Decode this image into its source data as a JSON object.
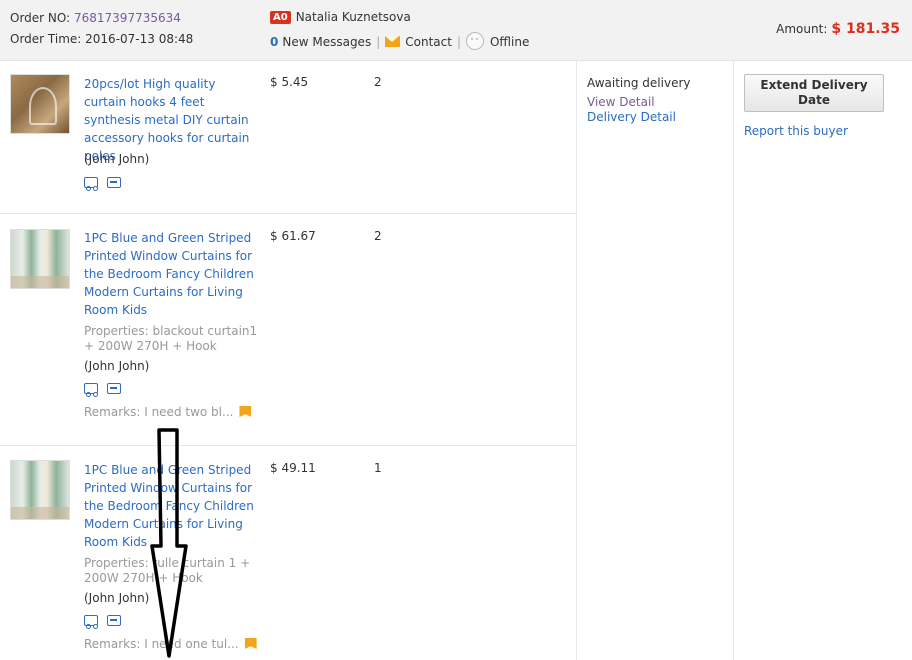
{
  "header": {
    "order_no_label": "Order NO:",
    "order_no": "76817397735634",
    "order_time_label": "Order Time:",
    "order_time": "2016-07-13 08:48",
    "buyer_badge": "A0",
    "buyer_name": "Natalia Kuznetsova",
    "message_count": "0",
    "messages_label": "New Messages",
    "contact_label": "Contact",
    "offline_label": "Offline",
    "amount_label": "Amount:",
    "amount_value": "$ 181.35"
  },
  "items": [
    {
      "title": "20pcs/lot High quality curtain hooks 4 feet synthesis metal DIY curtain accessory hooks for curtain poles",
      "properties": "",
      "buyer": "(John John)",
      "price": "$ 5.45",
      "qty": "2",
      "remarks": ""
    },
    {
      "title": "1PC Blue and Green Striped Printed Window Curtains for the Bedroom Fancy Children Modern Curtains for Living Room Kids",
      "properties": "Properties: blackout curtain1 + 200W 270H + Hook",
      "buyer": "(John John)",
      "price": "$ 61.67",
      "qty": "2",
      "remarks": "Remarks: I need two bl..."
    },
    {
      "title": "1PC Blue and Green Striped Printed Window Curtains for the Bedroom Fancy Children Modern Curtains for Living Room Kids",
      "properties": "Properties: tulle curtain 1 + 200W 270H + Hook",
      "buyer": "(John John)",
      "price": "$ 49.11",
      "qty": "1",
      "remarks": "Remarks: I need one tul..."
    }
  ],
  "status": {
    "text": "Awaiting delivery",
    "view_detail": "View Detail",
    "delivery_detail": "Delivery Detail"
  },
  "actions": {
    "extend_delivery": "Extend Delivery Date",
    "report_buyer": "Report this buyer"
  },
  "colors": {
    "link": "#2b6cc4",
    "amount": "#d9311f",
    "header_bg": "#f2f2f2",
    "flag": "#f2a51a"
  }
}
